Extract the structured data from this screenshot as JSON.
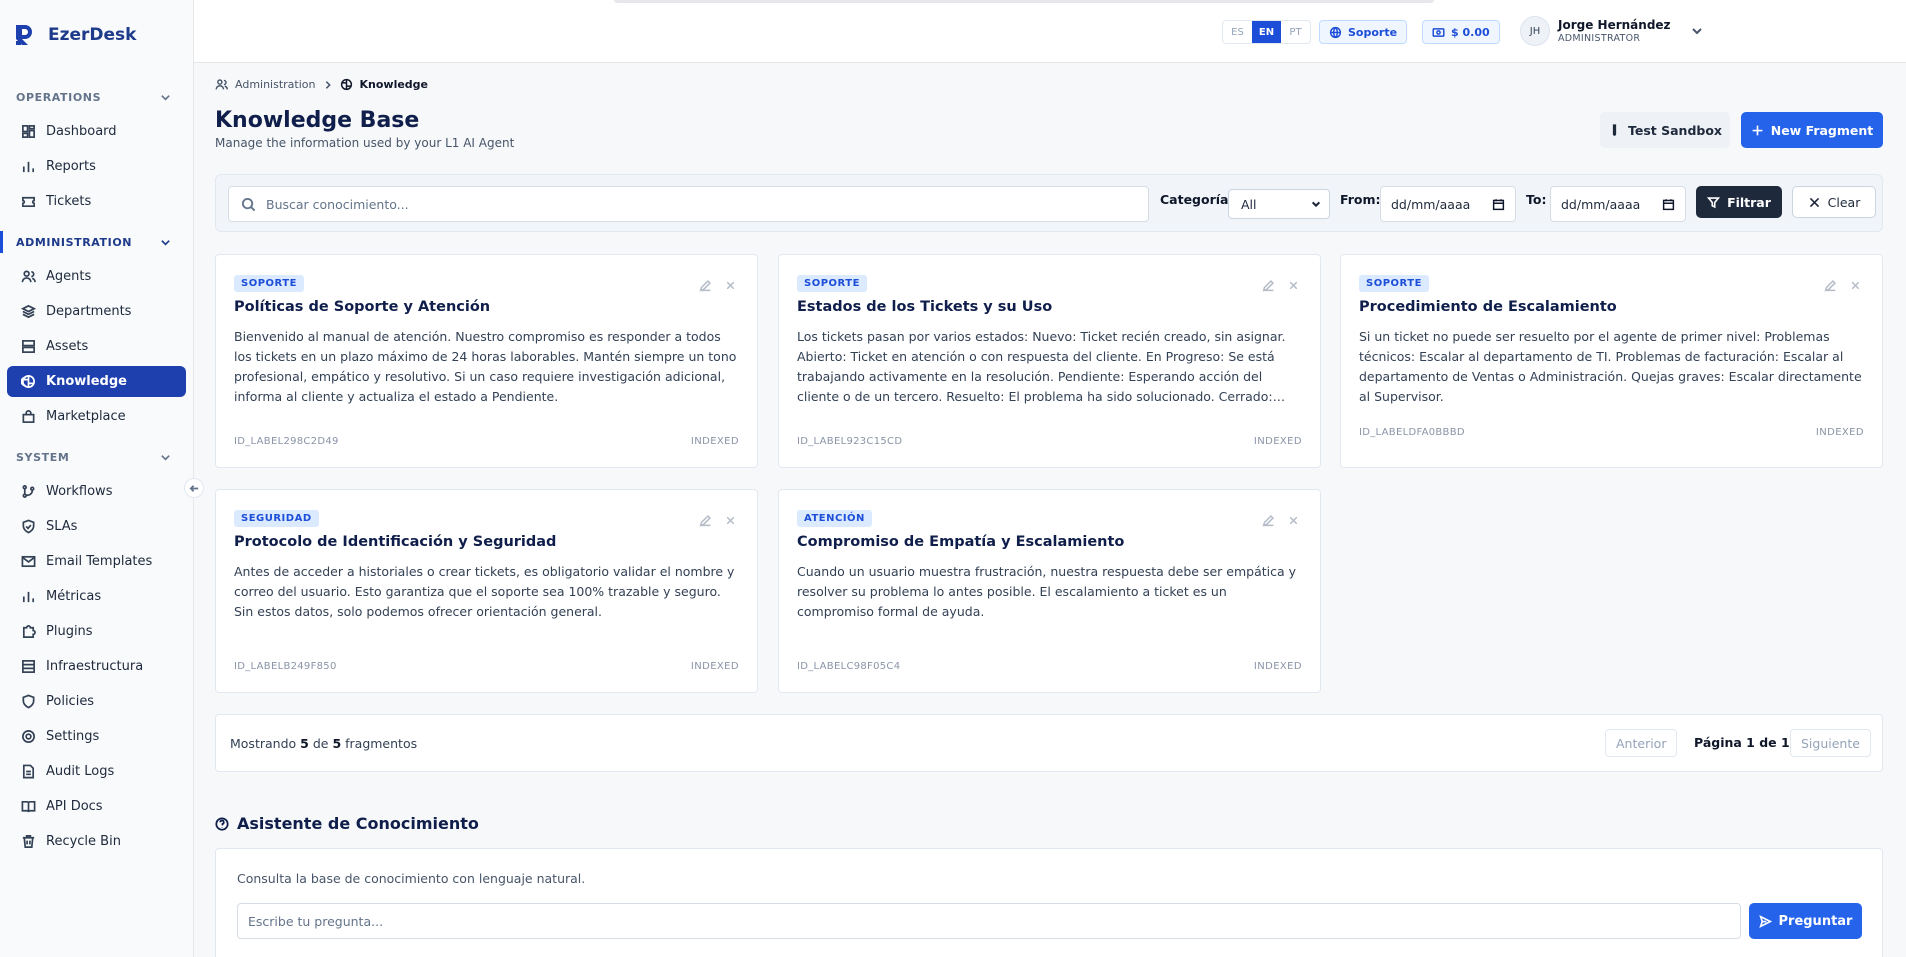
{
  "brand": {
    "name": "EzerDesk"
  },
  "sidebar": {
    "sections": [
      {
        "label": "OPERATIONS",
        "items": [
          {
            "label": "Dashboard",
            "icon": "dashboard-icon"
          },
          {
            "label": "Reports",
            "icon": "bar-chart-icon"
          },
          {
            "label": "Tickets",
            "icon": "ticket-icon"
          }
        ]
      },
      {
        "label": "ADMINISTRATION",
        "items": [
          {
            "label": "Agents",
            "icon": "users-icon"
          },
          {
            "label": "Departments",
            "icon": "layers-icon"
          },
          {
            "label": "Assets",
            "icon": "server-icon"
          },
          {
            "label": "Knowledge",
            "icon": "brain-icon",
            "active": true
          },
          {
            "label": "Marketplace",
            "icon": "bag-icon"
          }
        ]
      },
      {
        "label": "SYSTEM",
        "items": [
          {
            "label": "Workflows",
            "icon": "git-branch-icon"
          },
          {
            "label": "SLAs",
            "icon": "shield-check-icon"
          },
          {
            "label": "Email Templates",
            "icon": "mail-icon"
          },
          {
            "label": "Métricas",
            "icon": "bar-chart-icon"
          },
          {
            "label": "Plugins",
            "icon": "puzzle-icon"
          },
          {
            "label": "Infraestructura",
            "icon": "server-icon"
          },
          {
            "label": "Policies",
            "icon": "shield-icon"
          },
          {
            "label": "Settings",
            "icon": "gear-icon"
          },
          {
            "label": "Audit Logs",
            "icon": "file-text-icon"
          },
          {
            "label": "API Docs",
            "icon": "book-icon"
          },
          {
            "label": "Recycle Bin",
            "icon": "trash-icon"
          }
        ]
      }
    ]
  },
  "topbar": {
    "languages": [
      "ES",
      "EN",
      "PT"
    ],
    "active_language": "EN",
    "support_label": "Soporte",
    "balance_label": "$ 0.00",
    "user": {
      "initials": "JH",
      "name": "Jorge Hernández",
      "role": "ADMINISTRATOR"
    }
  },
  "breadcrumb": {
    "parent": "Administration",
    "current": "Knowledge"
  },
  "page": {
    "title": "Knowledge Base",
    "subtitle": "Manage the information used by your L1 AI Agent",
    "sandbox_label": "Test Sandbox",
    "new_label": "New Fragment"
  },
  "filters": {
    "search_placeholder": "Buscar conocimiento...",
    "category_label": "Categoría:",
    "category_value": "All",
    "from_label": "From:",
    "to_label": "To:",
    "date_placeholder": "dd/mm/aaaa",
    "filter_label": "Filtrar",
    "clear_label": "Clear"
  },
  "cards": [
    {
      "category": "SOPORTE",
      "title": "Políticas de Soporte y Atención",
      "body": "Bienvenido al manual de atención. Nuestro compromiso es responder a todos los tickets en un plazo máximo de 24 horas laborables. Mantén siempre un tono profesional, empático y resolutivo. Si un caso requiere investigación adicional, informa al cliente y actualiza el estado a Pendiente.",
      "id": "ID_LABEL298C2D49",
      "status": "INDEXED"
    },
    {
      "category": "SOPORTE",
      "title": "Estados de los Tickets y su Uso",
      "body": "Los tickets pasan por varios estados: Nuevo: Ticket recién creado, sin asignar. Abierto: Ticket en atención o con respuesta del cliente. En Progreso: Se está trabajando activamente en la resolución. Pendiente: Esperando acción del cliente o de un tercero. Resuelto: El problema ha sido solucionado. Cerrado: Confirmación final del cliente o cierre automático.",
      "id": "ID_LABEL923C15CD",
      "status": "INDEXED"
    },
    {
      "category": "SOPORTE",
      "title": "Procedimiento de Escalamiento",
      "body": "Si un ticket no puede ser resuelto por el agente de primer nivel: Problemas técnicos: Escalar al departamento de TI. Problemas de facturación: Escalar al departamento de Ventas o Administración. Quejas graves: Escalar directamente al Supervisor.",
      "id": "ID_LABELDFA0BBBD",
      "status": "INDEXED"
    },
    {
      "category": "SEGURIDAD",
      "title": "Protocolo de Identificación y Seguridad",
      "body": "Antes de acceder a historiales o crear tickets, es obligatorio validar el nombre y correo del usuario. Esto garantiza que el soporte sea 100% trazable y seguro. Sin estos datos, solo podemos ofrecer orientación general.",
      "id": "ID_LABELB249F850",
      "status": "INDEXED"
    },
    {
      "category": "ATENCIÓN",
      "title": "Compromiso de Empatía y Escalamiento",
      "body": "Cuando un usuario muestra frustración, nuestra respuesta debe ser empática y resolver su problema lo antes posible. El escalamiento a ticket es un compromiso formal de ayuda.",
      "id": "ID_LABELC98F05C4",
      "status": "INDEXED"
    }
  ],
  "pagination": {
    "prefix": "Mostrando",
    "shown": "5",
    "of": "de",
    "total": "5",
    "suffix": "fragmentos",
    "prev_label": "Anterior",
    "page_label": "Página 1 de 1",
    "next_label": "Siguiente"
  },
  "assistant": {
    "title": "Asistente de Conocimiento",
    "description": "Consulta la base de conocimiento con lenguaje natural.",
    "placeholder": "Escribe tu pregunta...",
    "ask_label": "Preguntar"
  },
  "colors": {
    "primary": "#2563eb",
    "nav_active": "#1e40af",
    "title": "#0f1e4a",
    "badge_bg": "#dbeafe"
  }
}
